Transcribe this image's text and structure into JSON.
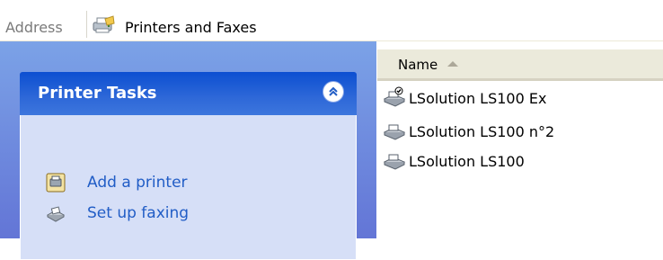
{
  "address_bar": {
    "label": "Address",
    "value": "Printers and Faxes",
    "icon": "printers-folder-icon"
  },
  "task_panel": {
    "title": "Printer Tasks",
    "collapse_icon": "chevron-double-up-icon",
    "links": [
      {
        "label": "Add a printer",
        "icon": "add-printer-icon"
      },
      {
        "label": "Set up faxing",
        "icon": "fax-icon"
      }
    ]
  },
  "file_list": {
    "column_header": "Name",
    "sort_icon": "sort-ascending-icon",
    "items": [
      {
        "label": "LSolution LS100 Ex",
        "icon": "printer-default-icon",
        "is_default": true
      },
      {
        "label": "LSolution LS100 n°2",
        "icon": "printer-icon",
        "is_default": false
      },
      {
        "label": "LSolution LS100",
        "icon": "printer-icon",
        "is_default": false
      }
    ]
  },
  "colors": {
    "left_pane_top": "#7ba2e7",
    "task_header": "#0c4fd1",
    "task_body": "#d6dff7",
    "link": "#215dc6"
  }
}
